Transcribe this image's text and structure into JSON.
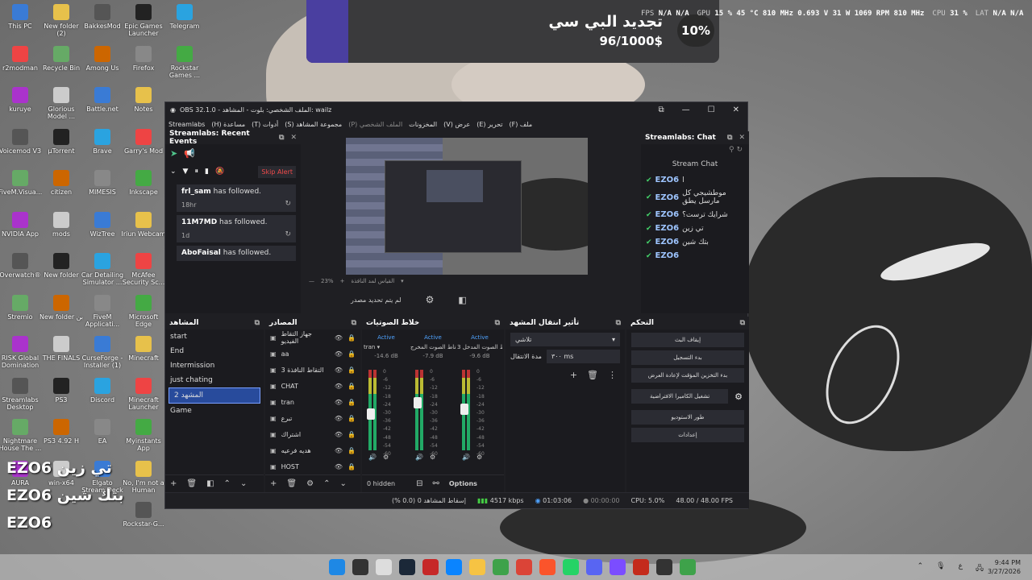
{
  "overlay": {
    "title": "تجديد البي سي",
    "goal": "96/1000$",
    "percent": "10%"
  },
  "stats": {
    "fps_label": "FPS",
    "fps_val1": "N/A",
    "fps_val2": "N/A",
    "gpu_label": "GPU",
    "gpu": "15 % 45 °C 810 MHz 0.693 V 31 W 1069 RPM 810 MHz",
    "cpu_label": "CPU",
    "cpu": "31 %",
    "lat_label": "LAT",
    "lat_val1": "N/A",
    "lat_val2": "N/A"
  },
  "desktop_icons": [
    {
      "label": "This PC"
    },
    {
      "label": "New folder (2)"
    },
    {
      "label": "BakkesMod"
    },
    {
      "label": "Epic Games Launcher"
    },
    {
      "label": "Telegram"
    },
    {
      "label": "r2modman"
    },
    {
      "label": "Recycle Bin"
    },
    {
      "label": "Among Us"
    },
    {
      "label": "Firefox"
    },
    {
      "label": "Rockstar Games ..."
    },
    {
      "label": "kuruye"
    },
    {
      "label": "Glorious Model ..."
    },
    {
      "label": "Battle.net"
    },
    {
      "label": "Notes"
    },
    {
      "label": "Voicemod V3"
    },
    {
      "label": "µTorrent"
    },
    {
      "label": "Brave"
    },
    {
      "label": "Garry's Mod"
    },
    {
      "label": "FiveM.Visua..."
    },
    {
      "label": "citizen"
    },
    {
      "label": "MIMESIS"
    },
    {
      "label": "Inkscape"
    },
    {
      "label": "NVIDIA App"
    },
    {
      "label": "mods"
    },
    {
      "label": "WizTree"
    },
    {
      "label": "Iriun Webcam"
    },
    {
      "label": "Overwatch®"
    },
    {
      "label": "New folder"
    },
    {
      "label": "Car Detailing Simulator ..."
    },
    {
      "label": "McAfee Security Sc..."
    },
    {
      "label": "Stremio"
    },
    {
      "label": "New folder بن"
    },
    {
      "label": "FiveM Applicati..."
    },
    {
      "label": "Microsoft Edge"
    },
    {
      "label": "RISK Global Domination"
    },
    {
      "label": "THE FINALS"
    },
    {
      "label": "CurseForge - Installer (1)"
    },
    {
      "label": "Minecraft"
    },
    {
      "label": "Streamlabs Desktop"
    },
    {
      "label": "PS3"
    },
    {
      "label": "Discord"
    },
    {
      "label": "Minecraft Launcher"
    },
    {
      "label": "Nightmare House The ..."
    },
    {
      "label": "PS3 4.92 H"
    },
    {
      "label": "EA"
    },
    {
      "label": "Myinstants App"
    },
    {
      "label": "AURA"
    },
    {
      "label": "win-x64"
    },
    {
      "label": "Elgato Stream Deck"
    },
    {
      "label": "No, I'm not a Human"
    },
    {
      "label": "Rockstar-G..."
    }
  ],
  "chat_overlay": [
    {
      "user": "EZO6",
      "msg": "تي زين"
    },
    {
      "user": "EZO6",
      "msg": "بتك شين"
    },
    {
      "user": "EZO6",
      "msg": ""
    }
  ],
  "obs": {
    "title": "OBS 32.1.0 - الملف الشخصي: بلوت - المشاهد: wailz",
    "menus": [
      "ملف (F)",
      "تحرير (E)",
      "عرض (V)",
      "المخزونات",
      "الملف الشخصي (P)",
      "مجموعة المشاهد (S)",
      "أدوات (T)",
      "مساعدة (H)",
      "Streamlabs"
    ],
    "events": {
      "title": "Streamlabs: Recent Events",
      "skip_alert": "Skip Alert",
      "items": [
        {
          "name": "frl_sam",
          "text": "has followed.",
          "time": "18hr"
        },
        {
          "name": "11M7MD",
          "text": "has followed.",
          "time": "1d"
        },
        {
          "name": "AboFaisal",
          "text": "has followed.",
          "time": ""
        }
      ]
    },
    "preview": {
      "zoom": "23%",
      "scene_line": "القياس لمد النافذة",
      "no_source": "لم يتم تحديد مصدر"
    },
    "chat": {
      "title": "Streamlabs: Chat",
      "header": "Stream Chat",
      "lines": [
        {
          "user": "EZO6",
          "msg": "ا"
        },
        {
          "user": "EZO6",
          "msg": "موطشيجي كل مارسل يطق"
        },
        {
          "user": "EZO6",
          "msg": "شرايك ترست؟"
        },
        {
          "user": "EZO6",
          "msg": "تي زين"
        },
        {
          "user": "EZO6",
          "msg": "بتك شين"
        },
        {
          "user": "EZO6",
          "msg": ""
        }
      ]
    },
    "scenes": {
      "title": "المشاهد",
      "items": [
        "start",
        "End",
        "Intermission",
        "just chating",
        "المشهد 2",
        "Game"
      ],
      "active_index": 4
    },
    "sources": {
      "title": "المصادر",
      "items": [
        "جهاز التقاط الفيديو",
        "aa",
        "التقاط النافذة 3",
        "CHAT",
        "tran",
        "تبرع",
        "اشتراك",
        "هديه فرعيه",
        "HOST"
      ]
    },
    "mixer": {
      "title": "خلاط الصوتيات",
      "channels": [
        {
          "status": "Active",
          "name": "tran",
          "db": "-14.6 dB"
        },
        {
          "status": "Active",
          "name": "التقاط الصوت المخرج",
          "db": "-7.9 dB"
        },
        {
          "status": "Active",
          "name": "التقاط الصوت المدخل 3",
          "db": "-9.6 dB"
        }
      ],
      "scale": [
        "0",
        "-6",
        "-12",
        "-18",
        "-24",
        "-30",
        "-36",
        "-42",
        "-48",
        "-54",
        "-60"
      ],
      "hidden": "0 hidden",
      "options": "Options"
    },
    "transitions": {
      "title": "تأثير انتقال المشهد",
      "selected": "تلاشي",
      "duration_label": "مدة الانتقال",
      "duration": "٣٠٠ ms"
    },
    "controls": {
      "title": "التحكم",
      "buttons": [
        "إيقاف البث",
        "بدء التسجيل",
        "بدء التخزين المؤقت لإعادة العرض",
        "تشغيل الكاميرا الافتراضية",
        "طور الاستوديو",
        "إعدادات"
      ]
    },
    "status": {
      "dropped": "إسقاط المشاهد 0 (0.0 %)",
      "bitrate": "4517 kbps",
      "stream_time": "01:03:06",
      "rec_time": "00:00:00",
      "cpu": "CPU: 5.0%",
      "fps": "48.00 / 48.00 FPS"
    }
  },
  "taskbar": {
    "time": "9:44 PM",
    "date": "3/27/2026",
    "lang": "ع"
  }
}
